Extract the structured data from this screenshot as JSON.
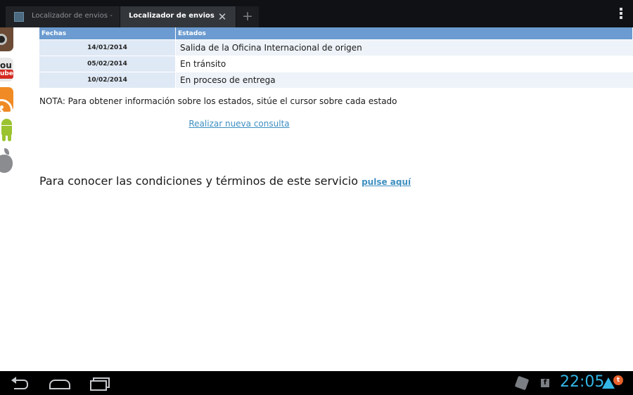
{
  "browser": {
    "tabs": [
      {
        "title": "Localizador de envios - ...",
        "active": false
      },
      {
        "title": "Localizador de envios - C...",
        "active": true
      }
    ],
    "new_tab_glyph": "+",
    "close_glyph": "✕"
  },
  "side_icons": [
    "instagram-icon",
    "youtube-icon",
    "rss-icon",
    "android-icon",
    "apple-icon"
  ],
  "youtube_icon": {
    "top": "ou",
    "bottom": "ube"
  },
  "table": {
    "headers": [
      "Fechas",
      "Estados"
    ],
    "rows": [
      {
        "date": "14/01/2014",
        "status": "Salida de la Oficina Internacional de origen"
      },
      {
        "date": "05/02/2014",
        "status": "En tránsito"
      },
      {
        "date": "10/02/2014",
        "status": "En proceso de entrega"
      }
    ]
  },
  "note": "NOTA: Para obtener información sobre los estados, sitúe el cursor sobre cada estado",
  "new_query_link": "Realizar nueva consulta",
  "terms": {
    "text": "Para conocer las condiciones y términos de este servicio",
    "link": "pulse aquí"
  },
  "system_bar": {
    "clock": "22:05",
    "notification_badge": "t",
    "facebook_glyph": "f",
    "accent_color": "#33b5e5"
  }
}
